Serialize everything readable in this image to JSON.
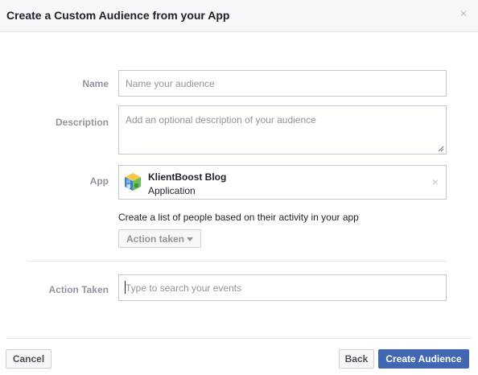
{
  "dialog": {
    "title": "Create a Custom Audience from your App",
    "close_glyph": "×"
  },
  "form": {
    "name_label": "Name",
    "name_placeholder": "Name your audience",
    "description_label": "Description",
    "description_placeholder": "Add an optional description of your audience",
    "app_label": "App",
    "app": {
      "name": "KlientBoost Blog",
      "type": "Application",
      "icon": "app-cube-icon",
      "remove_glyph": "×"
    },
    "helper_text": "Create a list of people based on their activity in your app",
    "action_dropdown_label": "Action taken",
    "action_taken_label": "Action Taken",
    "event_search_placeholder": "Type to search your events"
  },
  "footer": {
    "cancel_label": "Cancel",
    "back_label": "Back",
    "create_label": "Create Audience"
  },
  "colors": {
    "primary": "#4267b2",
    "label_gray": "#90949c",
    "header_bg": "#f6f7f9",
    "border": "#bdc7d8"
  }
}
